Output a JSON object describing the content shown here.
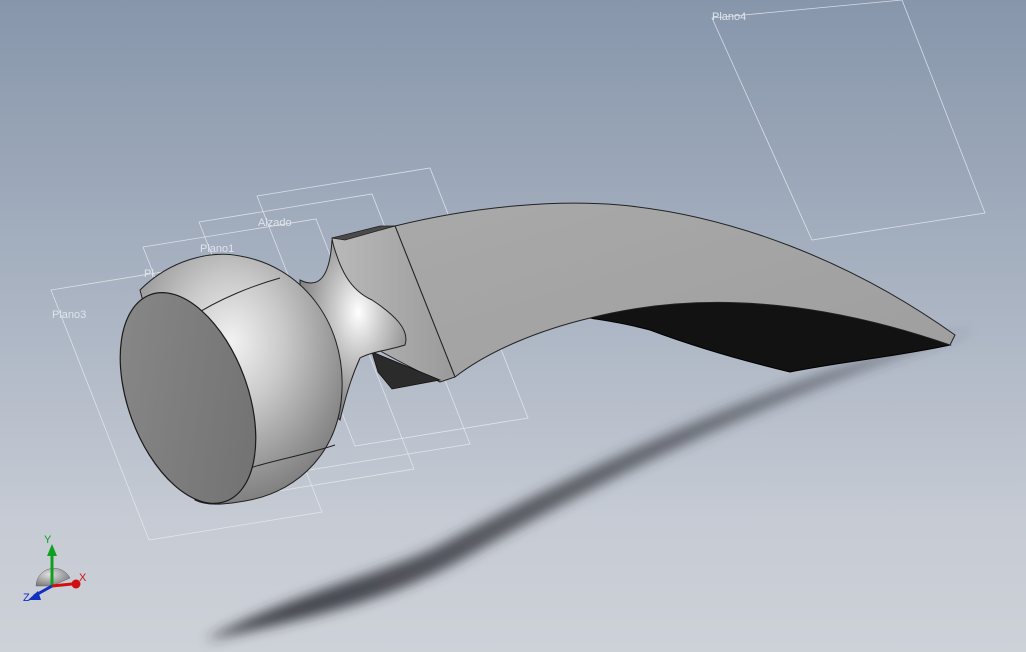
{
  "viewport": {
    "planes": {
      "plano4": "Plano4",
      "alzado": "Alzado",
      "plano1": "Plano1",
      "plano2": "Pl",
      "plano3": "Plano3"
    },
    "triad": {
      "x": "X",
      "y": "Y",
      "z": "Z"
    },
    "colors": {
      "x_axis": "#d01010",
      "y_axis": "#10a020",
      "z_axis": "#1030c0",
      "plane_edge": "#e6e9ef"
    }
  }
}
